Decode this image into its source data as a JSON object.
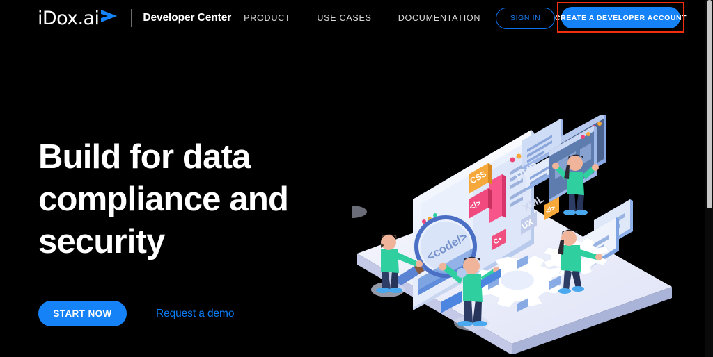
{
  "navbar": {
    "logo_text": "iDox.ai",
    "logo_mark": "blue-chevron-arrow-icon",
    "brand": "Developer Center",
    "links": [
      {
        "label": "PRODUCT",
        "name": "nav-link-product"
      },
      {
        "label": "USE CASES",
        "name": "nav-link-use-cases"
      },
      {
        "label": "DOCUMENTATION",
        "name": "nav-link-documentation"
      }
    ],
    "signin_label": "SIGN IN",
    "create_account_label": "CREATE A DEVELOPER ACCOUNT",
    "annotation_color": "#f42f10"
  },
  "hero": {
    "heading_lines": [
      "Build for data",
      "compliance and",
      "security"
    ],
    "primary_cta": "START NOW",
    "secondary_cta": "Request a demo"
  },
  "illustration": {
    "name": "isometric-developer-workspace-illustration",
    "tech_labels": [
      {
        "text": "CSS",
        "color": "#f7a83a"
      },
      {
        "text": "</>",
        "color": "#ef4476"
      },
      {
        "text": "PHP",
        "color": "#e9edf8"
      },
      {
        "text": "XML",
        "color": "#d7dcef"
      },
      {
        "text": "UX",
        "color": "#c4ccea"
      },
      {
        "text": "C+",
        "color": "#ef4476"
      },
      {
        "text": "</>",
        "color": "#f7a83a"
      }
    ],
    "code_text": "<code/>",
    "people_count": 4,
    "palette": {
      "platform_top": "#eceffb",
      "platform_side": "#b9c0e0",
      "screen_light": "#f4f7ff",
      "screen_blue": "#9ab4e8",
      "accent_blue": "#2f6fe0",
      "skin": "#f0b49a",
      "shirt_teal": "#2fcfa0",
      "pants_navy": "#2e3d66",
      "shoes_blue": "#4aa8ef"
    }
  },
  "colors": {
    "background": "#000000",
    "brand_blue": "#1583f7",
    "link_blue": "#0b7bf5",
    "text_white": "#ffffff",
    "nav_grey": "#d8d8d8"
  },
  "scrollbar": {
    "name": "vertical-scrollbar"
  }
}
